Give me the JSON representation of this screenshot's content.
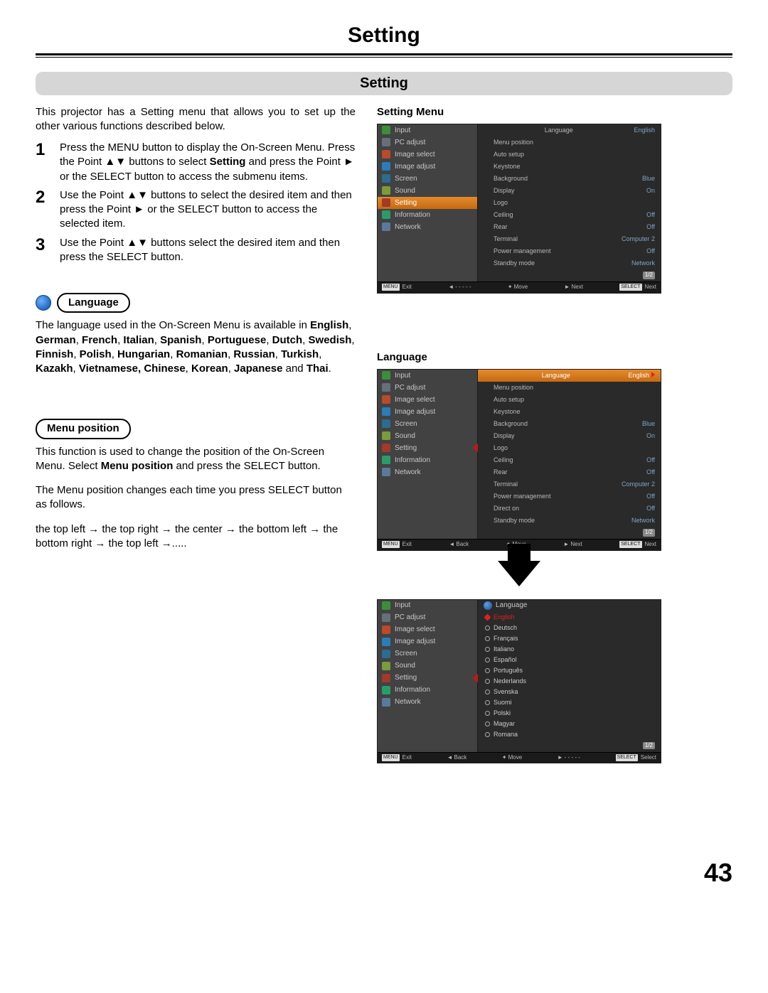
{
  "page": {
    "title": "Setting",
    "subtitle": "Setting",
    "number": "43"
  },
  "intro": "This projector has a Setting menu that allows you to set up the other various functions described below.",
  "steps": {
    "n1": "1",
    "t1a": "Press the MENU button to display the On-Screen Menu. Press the Point ▲▼ buttons to select ",
    "t1b": "Setting",
    "t1c": " and press the Point ► or the SELECT button to access the submenu items.",
    "n2": "2",
    "t2": "Use the Point ▲▼ buttons to select the desired item and then press the Point ► or the SELECT button to access the selected item.",
    "n3": "3",
    "t3": "Use the Point ▲▼ buttons select the desired item and then press the SELECT button."
  },
  "lang": {
    "chip": "Language",
    "p1a": "The language used in the On-Screen Menu is available in ",
    "p1b": "English",
    "c": ", ",
    "p1c": "German",
    "p1d": "French",
    "p1e": "Italian",
    "p1f": "Spanish",
    "p1g": "Portuguese",
    "p1h": "Dutch",
    "p1i": "Swedish",
    "p1j": "Finnish",
    "p1k": "Polish",
    "p1l": "Hungarian",
    "p1m": "Romanian",
    "p1n": "Russian",
    "p1o": "Turkish",
    "p1p": "Kazakh",
    "p1q": "Vietnamese, Chinese",
    "p1r": "Korean",
    "p1s": "Japanese",
    "and": " and ",
    "p1t": "Thai",
    "dot": "."
  },
  "mpos": {
    "chip": "Menu position",
    "p1a": "This function is used to change the position of the On-Screen Menu. Select ",
    "p1b": "Menu position",
    "p1c": " and press the SELECT button.",
    "p2": "The Menu position changes each time you press SELECT button as follows.",
    "p3": "the top left  → the top right  → the center → the bottom left → the bottom right → the top left →....."
  },
  "osd_titles": {
    "setting_menu": "Setting Menu",
    "language": "Language"
  },
  "menu_left": {
    "input": "Input",
    "pc": "PC adjust",
    "isel": "Image select",
    "iadj": "Image adjust",
    "screen": "Screen",
    "sound": "Sound",
    "setting": "Setting",
    "info": "Information",
    "net": "Network"
  },
  "menu_right": {
    "language": "Language",
    "lang_val": "English",
    "menupos": "Menu position",
    "autosetup": "Auto setup",
    "keystone": "Keystone",
    "background": "Background",
    "bg_val": "Blue",
    "display": "Display",
    "disp_val": "On",
    "logo": "Logo",
    "ceiling": "Ceiling",
    "ceil_val": "Off",
    "rear": "Rear",
    "rear_val": "Off",
    "terminal": "Terminal",
    "term_val": "Computer 2",
    "power": "Power management",
    "pm_val": "Off",
    "direct": "Direct on",
    "direct_val": "Off",
    "standby": "Standby mode",
    "sb_val": "Network",
    "page": "1/2"
  },
  "footer": {
    "menu": "MENU",
    "exit": "Exit",
    "back": "Back",
    "dashes": "- - - - -",
    "move": "Move",
    "next": "Next",
    "select": "SELECT",
    "selectlbl": "Select",
    "nextlbl": "Next"
  },
  "arrows": {
    "lr": "◄",
    "ud": "✦",
    "r": "►"
  },
  "lang_list": {
    "head": "Language",
    "sel": "English",
    "de": "Deutsch",
    "fr": "Français",
    "it": "Italiano",
    "es": "Español",
    "pt": "Português",
    "nl": "Nederlands",
    "sv": "Svenska",
    "fi": "Suomi",
    "pl": "Polski",
    "hu": "Magyar",
    "ro": "Romana",
    "page": "1/2"
  }
}
